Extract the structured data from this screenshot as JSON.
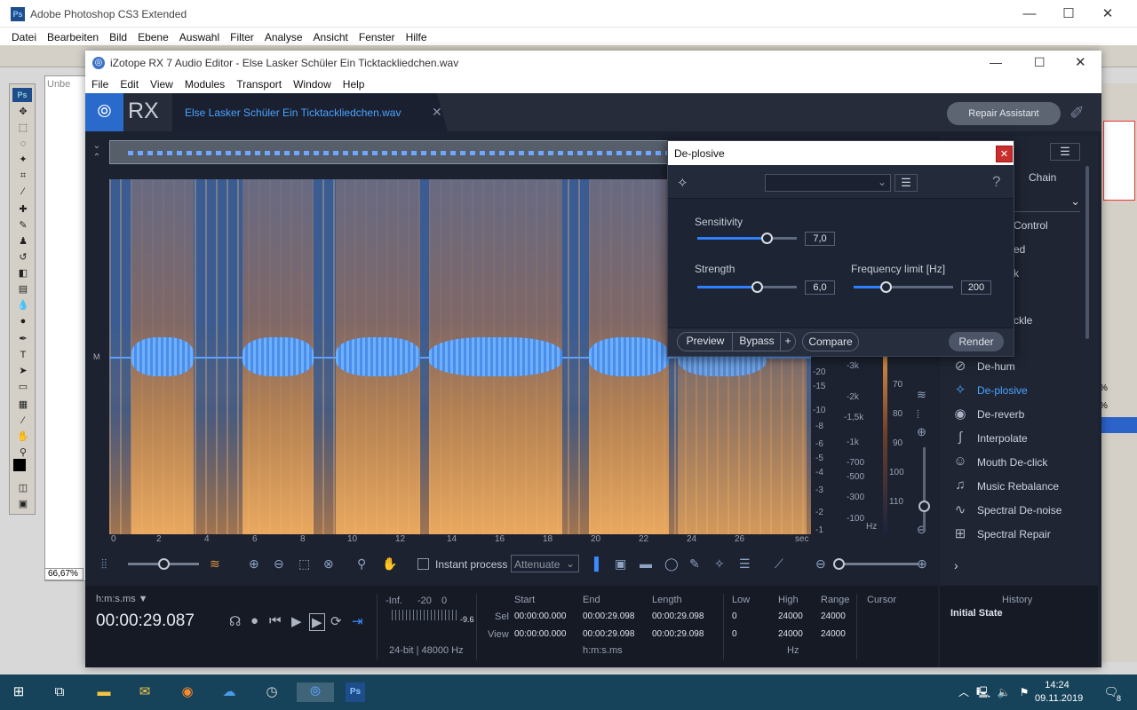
{
  "photoshop": {
    "title": "Adobe Photoshop CS3 Extended",
    "menu": [
      "Datei",
      "Bearbeiten",
      "Bild",
      "Ebene",
      "Auswahl",
      "Filter",
      "Analyse",
      "Ansicht",
      "Fenster",
      "Hilfe"
    ],
    "doc_tab": "Unbe",
    "zoom": "66,67%",
    "logo": "Ps",
    "right_pct": [
      "%",
      "%"
    ]
  },
  "rx": {
    "title": "iZotope RX 7 Audio Editor - Else Lasker Schüler Ein Ticktackliedchen.wav",
    "menu": [
      "File",
      "Edit",
      "View",
      "Modules",
      "Transport",
      "Window",
      "Help"
    ],
    "logo_text": "RX",
    "file_tab": "Else Lasker Schüler Ein Ticktackliedchen.wav",
    "repair_assistant": "Repair Assistant",
    "channel_label": "M",
    "x_ticks": [
      "0",
      "2",
      "4",
      "6",
      "8",
      "10",
      "12",
      "14",
      "16",
      "18",
      "20",
      "22",
      "24",
      "26",
      "sec"
    ],
    "db_ticks": [
      "-20",
      "-15",
      "-10",
      "-8",
      "-6",
      "-5",
      "-4",
      "-3",
      "-2",
      "-1"
    ],
    "hz_ticks": [
      "-3k",
      "-2k",
      "-1,5k",
      "-1k",
      "-700",
      "-500",
      "-300",
      "-100",
      "Hz"
    ],
    "cbar_ticks": [
      "70",
      "80",
      "90",
      "100",
      "110"
    ],
    "toolbar": {
      "instant_process": "Instant process",
      "attenuate": "Attenuate"
    },
    "bottom": {
      "time_format": "h:m:s.ms ▼",
      "time": "00:00:29.087",
      "meter_labels": [
        "-Inf.",
        "-20",
        "0"
      ],
      "meter_peak": "-9.6",
      "format": "24-bit | 48000 Hz",
      "sel_label": "Sel",
      "view_label": "View",
      "start_label": "Start",
      "end_label": "End",
      "length_label": "Length",
      "sel_start": "00:00:00.000",
      "sel_end": "00:00:29.098",
      "sel_length": "00:00:29.098",
      "view_start": "00:00:00.000",
      "view_end": "00:00:29.098",
      "view_length": "00:00:29.098",
      "hms_label": "h:m:s.ms",
      "low_label": "Low",
      "high_label": "High",
      "range_label": "Range",
      "cursor_label": "Cursor",
      "sel_low": "0",
      "sel_high": "24000",
      "sel_range": "24000",
      "view_low": "0",
      "view_high": "24000",
      "view_range": "24000",
      "hz_label": "Hz"
    },
    "modules_partial": [
      "Chain",
      "Control",
      "ed",
      "k",
      "ckle"
    ],
    "modules": [
      {
        "label": "De-hum",
        "icon": "dehum-icon",
        "glyph": "⊘",
        "active": false
      },
      {
        "label": "De-plosive",
        "icon": "deplosive-icon",
        "glyph": "✧",
        "active": true
      },
      {
        "label": "De-reverb",
        "icon": "dereverb-icon",
        "glyph": "◉",
        "active": false
      },
      {
        "label": "Interpolate",
        "icon": "interpolate-icon",
        "glyph": "∫",
        "active": false
      },
      {
        "label": "Mouth De-click",
        "icon": "mouth-declick-icon",
        "glyph": "☺",
        "active": false
      },
      {
        "label": "Music Rebalance",
        "icon": "music-rebalance-icon",
        "glyph": "♫",
        "active": false
      },
      {
        "label": "Spectral De-noise",
        "icon": "spectral-denoise-icon",
        "glyph": "∿",
        "active": false
      },
      {
        "label": "Spectral Repair",
        "icon": "spectral-repair-icon",
        "glyph": "⊞",
        "active": false
      }
    ],
    "history": {
      "title": "History",
      "item": "Initial State"
    }
  },
  "deplosive": {
    "title": "De-plosive",
    "sensitivity_label": "Sensitivity",
    "sensitivity_value": "7,0",
    "sensitivity_fraction": 0.7,
    "strength_label": "Strength",
    "strength_value": "6,0",
    "strength_fraction": 0.6,
    "freq_label": "Frequency limit [Hz]",
    "freq_value": "200",
    "freq_fraction": 0.32,
    "preview": "Preview",
    "bypass": "Bypass",
    "plus": "+",
    "compare": "Compare",
    "render": "Render",
    "help": "?"
  },
  "taskbar": {
    "time": "14:24",
    "date": "09.11.2019",
    "notifications": "8"
  },
  "colors": {
    "accent": "#4aa3ff",
    "rx_bg": "#1c2230",
    "close_red": "#c72f2f"
  }
}
